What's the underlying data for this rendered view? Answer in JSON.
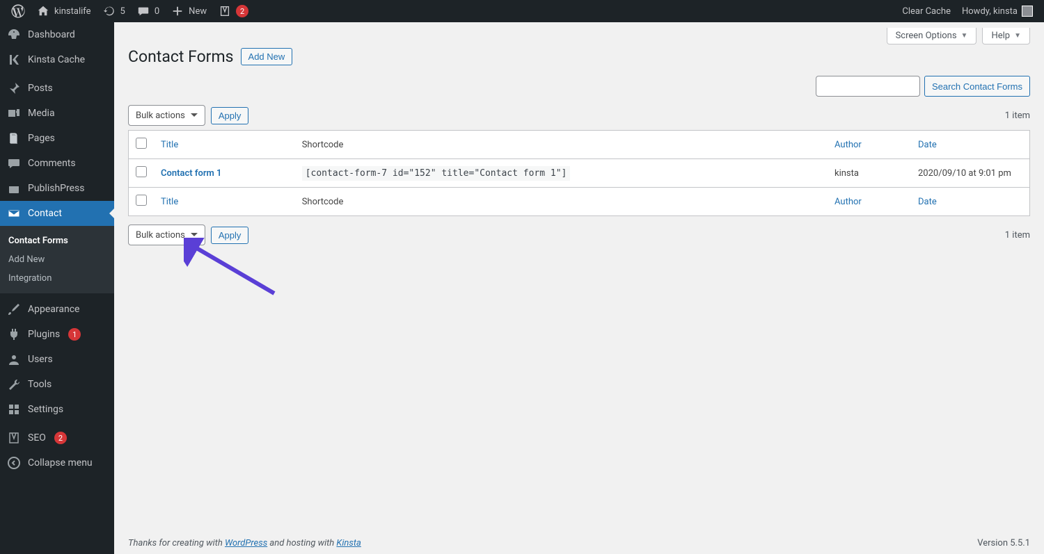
{
  "adminbar": {
    "left": {
      "site_name": "kinstalife",
      "updates": "5",
      "comments": "0",
      "new_label": "New",
      "yoast_badge": "2"
    },
    "right": {
      "clear_cache": "Clear Cache",
      "howdy": "Howdy, kinsta"
    }
  },
  "sidebar": {
    "dashboard": "Dashboard",
    "kinsta_cache": "Kinsta Cache",
    "posts": "Posts",
    "media": "Media",
    "pages": "Pages",
    "comments": "Comments",
    "publishpress": "PublishPress",
    "contact": "Contact",
    "submenu": {
      "contact_forms": "Contact Forms",
      "add_new": "Add New",
      "integration": "Integration"
    },
    "appearance": "Appearance",
    "plugins": "Plugins",
    "plugins_badge": "1",
    "users": "Users",
    "tools": "Tools",
    "settings": "Settings",
    "seo": "SEO",
    "seo_badge": "2",
    "collapse": "Collapse menu"
  },
  "top_panels": {
    "screen_options": "Screen Options",
    "help": "Help"
  },
  "page": {
    "title": "Contact Forms",
    "add_new": "Add New",
    "search_btn": "Search Contact Forms",
    "bulk_label": "Bulk actions",
    "apply": "Apply",
    "count": "1 item"
  },
  "table": {
    "headers": {
      "title": "Title",
      "shortcode": "Shortcode",
      "author": "Author",
      "date": "Date"
    },
    "row": {
      "title": "Contact form 1",
      "shortcode": "[contact-form-7 id=\"152\" title=\"Contact form 1\"]",
      "author": "kinsta",
      "date": "2020/09/10 at 9:01 pm"
    }
  },
  "footer": {
    "thanks_prefix": "Thanks for creating with ",
    "wordpress": "WordPress",
    "hosting": " and hosting with ",
    "kinsta": "Kinsta",
    "version": "Version 5.5.1"
  }
}
